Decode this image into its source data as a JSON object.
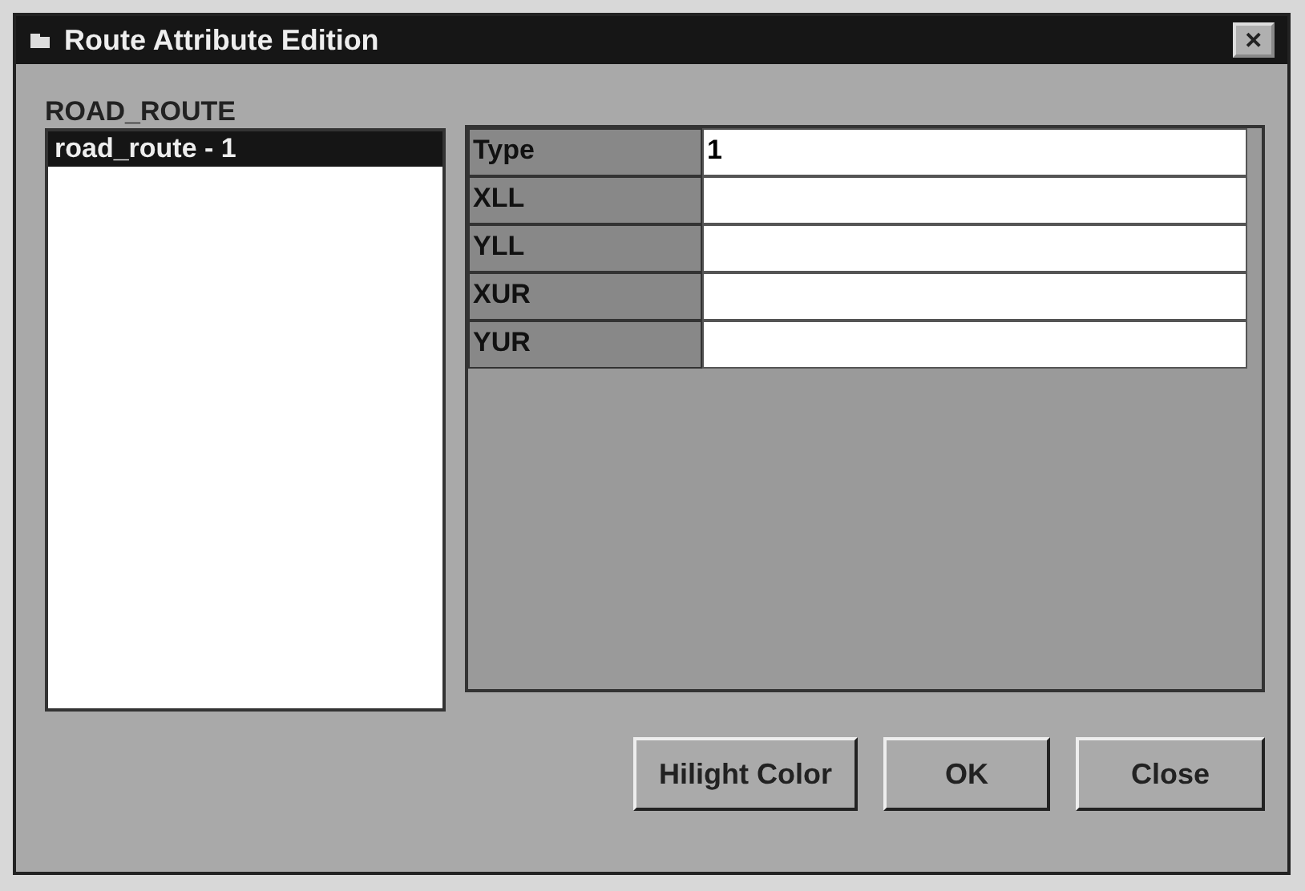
{
  "window": {
    "title": "Route Attribute Edition",
    "close_glyph": "✕"
  },
  "list": {
    "label": "ROAD_ROUTE",
    "items": [
      {
        "text": "road_route - 1",
        "selected": true
      }
    ]
  },
  "attributes": [
    {
      "name": "Type",
      "value": "1"
    },
    {
      "name": "XLL"
    },
    {
      "name": "YLL"
    },
    {
      "name": "XUR"
    },
    {
      "name": "YUR"
    }
  ],
  "buttons": [
    "Hilight Color",
    "OK",
    "Close"
  ]
}
